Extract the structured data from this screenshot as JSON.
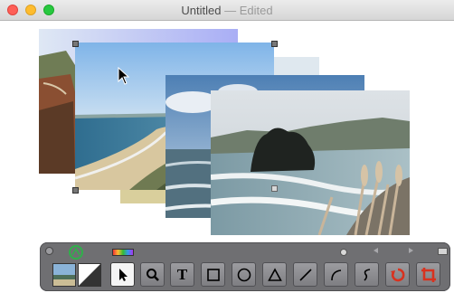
{
  "window": {
    "title": "Untitled",
    "separator": "—",
    "status": "Edited"
  },
  "colors": {
    "selection_handle": "#777777",
    "hud_background": "#6f6f72",
    "accent_green": "#2fb04a",
    "undo_red": "#d8321f"
  },
  "toolbar": {
    "tools": [
      {
        "name": "arrow-tool",
        "icon": "arrow-cursor-icon",
        "selected": true
      },
      {
        "name": "zoom-tool",
        "icon": "magnifier-icon"
      },
      {
        "name": "text-tool",
        "icon": "text-T-icon",
        "label": "T"
      },
      {
        "name": "rectangle-tool",
        "icon": "square-icon"
      },
      {
        "name": "oval-tool",
        "icon": "circle-icon"
      },
      {
        "name": "triangle-tool",
        "icon": "triangle-icon"
      },
      {
        "name": "line-tool",
        "icon": "line-icon"
      },
      {
        "name": "arc-tool",
        "icon": "arc-icon"
      },
      {
        "name": "freehand-tool",
        "icon": "squiggle-icon"
      },
      {
        "name": "rotate-tool",
        "icon": "rotate-icon"
      },
      {
        "name": "crop-tool",
        "icon": "crop-icon"
      }
    ]
  }
}
